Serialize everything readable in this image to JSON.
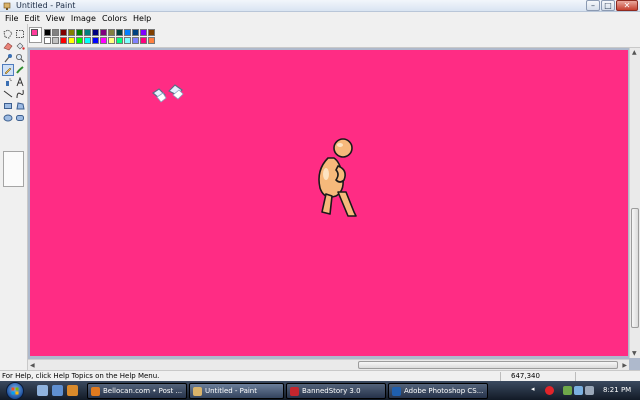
{
  "window": {
    "title": "Untitled - Paint",
    "buttons": {
      "minimize": "–",
      "maximize": "□",
      "close": "✕"
    }
  },
  "menu": [
    "File",
    "Edit",
    "View",
    "Image",
    "Colors",
    "Help"
  ],
  "colors": {
    "canvas_background": "#ff2c84",
    "foreground": "#ff3d9c",
    "background": "#ff3d9c"
  },
  "palette": [
    "#000000",
    "#808080",
    "#800000",
    "#808000",
    "#008000",
    "#008080",
    "#000080",
    "#800080",
    "#808040",
    "#004040",
    "#0080ff",
    "#004080",
    "#8000ff",
    "#804000",
    "#ffffff",
    "#c0c0c0",
    "#ff0000",
    "#ffff00",
    "#00ff00",
    "#00ffff",
    "#0000ff",
    "#ff00ff",
    "#ffff80",
    "#00ff80",
    "#80ffff",
    "#8080ff",
    "#ff0080",
    "#ff8040"
  ],
  "tools": [
    "free-select",
    "rect-select",
    "eraser",
    "fill",
    "color-picker",
    "magnifier",
    "pencil",
    "brush",
    "airbrush",
    "text",
    "line",
    "curve",
    "rectangle",
    "polygon",
    "ellipse",
    "rounded-rectangle"
  ],
  "selected_tool": "pencil",
  "status": {
    "help_text": "For Help, click Help Topics on the Help Menu.",
    "coordinates": "647,340"
  },
  "taskbar": {
    "buttons": [
      {
        "label": "Bellocan.com • Post ...",
        "icon": "firefox-icon",
        "active": false
      },
      {
        "label": "Untitled - Paint",
        "icon": "paint-icon",
        "active": true
      },
      {
        "label": "BannedStory 3.0",
        "icon": "bannedstory-icon",
        "active": false
      },
      {
        "label": "Adobe Photoshop CS...",
        "icon": "photoshop-icon",
        "active": false
      }
    ],
    "clock": "8:21 PM"
  }
}
